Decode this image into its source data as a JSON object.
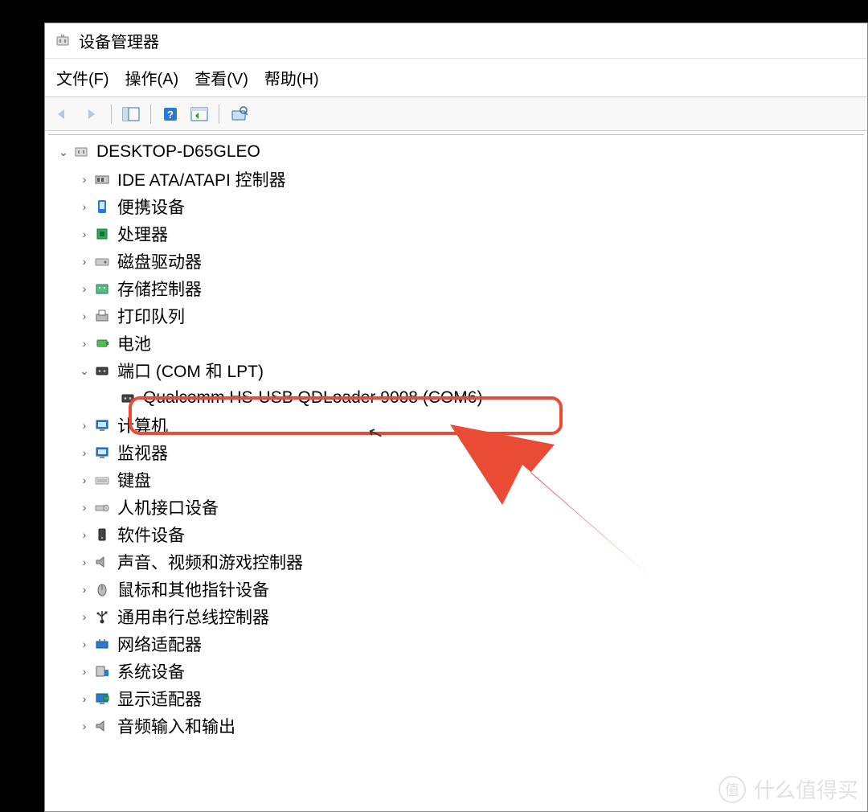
{
  "window": {
    "title": "设备管理器"
  },
  "menu": {
    "file": "文件(F)",
    "action": "操作(A)",
    "view": "查看(V)",
    "help": "帮助(H)"
  },
  "tree": {
    "root": "DESKTOP-D65GLEO",
    "items": [
      {
        "label": "IDE ATA/ATAPI 控制器",
        "icon": "ide-controller-icon",
        "expanded": false
      },
      {
        "label": "便携设备",
        "icon": "portable-device-icon",
        "expanded": false
      },
      {
        "label": "处理器",
        "icon": "processor-icon",
        "expanded": false
      },
      {
        "label": "磁盘驱动器",
        "icon": "disk-drive-icon",
        "expanded": false
      },
      {
        "label": "存储控制器",
        "icon": "storage-controller-icon",
        "expanded": false
      },
      {
        "label": "打印队列",
        "icon": "print-queue-icon",
        "expanded": false
      },
      {
        "label": "电池",
        "icon": "battery-icon",
        "expanded": false
      },
      {
        "label": "端口 (COM 和 LPT)",
        "icon": "ports-icon",
        "expanded": true,
        "children": [
          {
            "label": "Qualcomm HS-USB QDLoader 9008 (COM6)",
            "icon": "com-port-icon"
          }
        ]
      },
      {
        "label": "计算机",
        "icon": "computer-icon",
        "expanded": false
      },
      {
        "label": "监视器",
        "icon": "monitor-icon",
        "expanded": false
      },
      {
        "label": "键盘",
        "icon": "keyboard-icon",
        "expanded": false
      },
      {
        "label": "人机接口设备",
        "icon": "hid-icon",
        "expanded": false
      },
      {
        "label": "软件设备",
        "icon": "software-device-icon",
        "expanded": false
      },
      {
        "label": "声音、视频和游戏控制器",
        "icon": "sound-video-icon",
        "expanded": false
      },
      {
        "label": "鼠标和其他指针设备",
        "icon": "mouse-icon",
        "expanded": false
      },
      {
        "label": "通用串行总线控制器",
        "icon": "usb-controller-icon",
        "expanded": false
      },
      {
        "label": "网络适配器",
        "icon": "network-adapter-icon",
        "expanded": false
      },
      {
        "label": "系统设备",
        "icon": "system-device-icon",
        "expanded": false
      },
      {
        "label": "显示适配器",
        "icon": "display-adapter-icon",
        "expanded": false
      },
      {
        "label": "音频输入和输出",
        "icon": "audio-io-icon",
        "expanded": false
      }
    ]
  },
  "annotation": {
    "highlight_color": "#e94b35"
  },
  "watermark": {
    "badge": "值",
    "text": "什么值得买"
  }
}
